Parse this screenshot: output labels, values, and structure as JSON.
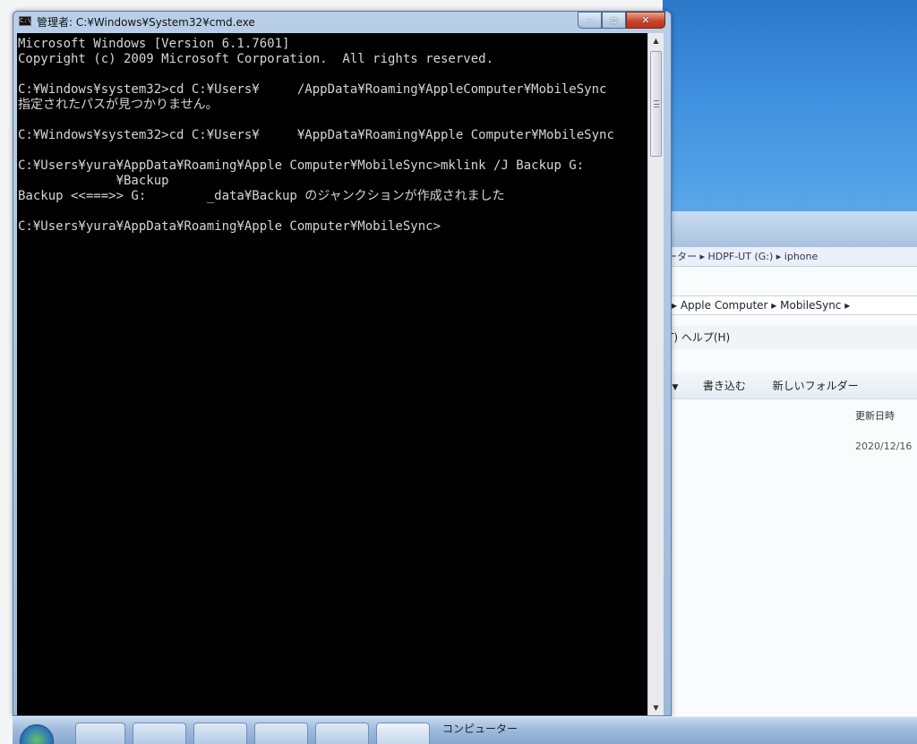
{
  "cmd": {
    "title": "管理者: C:¥Windows¥System32¥cmd.exe",
    "icon_label": "C:\\",
    "buttons": {
      "minimize": "–",
      "maximize": "▫",
      "close": "✕"
    },
    "lines": [
      "Microsoft Windows [Version 6.1.7601]",
      "Copyright (c) 2009 Microsoft Corporation.  All rights reserved.",
      "",
      "C:¥Windows¥system32>cd C:¥Users¥     /AppData¥Roaming¥AppleComputer¥MobileSync",
      "指定されたパスが見つかりません。",
      "",
      "C:¥Windows¥system32>cd C:¥Users¥     ¥AppData¥Roaming¥Apple Computer¥MobileSync",
      "",
      "C:¥Users¥yura¥AppData¥Roaming¥Apple Computer¥MobileSync>mklink /J Backup G:",
      "             ¥Backup",
      "Backup <<===>> G:        _data¥Backup のジャンクションが作成されました",
      "",
      "C:¥Users¥yura¥AppData¥Roaming¥Apple Computer¥MobileSync>"
    ]
  },
  "explorer": {
    "address_top": "ーター ▸ HDPF-UT (G:) ▸        iphone",
    "address": "▸ Apple Computer ▸ MobileSync ▸",
    "menu_help": "T)  ヘルプ(H)",
    "toolbar": {
      "burn": "書き込む",
      "new_folder": "新しいフォルダー"
    },
    "column_modified": "更新日時",
    "row_modified": "2020/12/16"
  },
  "taskbar": {
    "explorer_label": "コンピューター"
  },
  "colors": {
    "console_bg": "#000000",
    "console_text": "#d6d6d6",
    "close_button": "#c9462c"
  }
}
